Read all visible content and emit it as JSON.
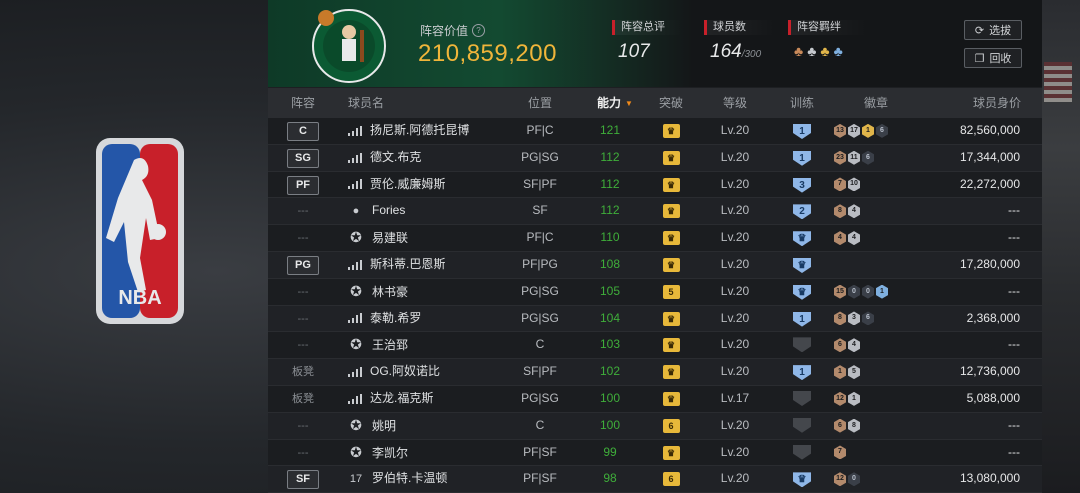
{
  "header": {
    "value_label": "阵容价值",
    "value": "210,859,200",
    "stats": [
      {
        "label": "阵容总评",
        "value": "107",
        "suffix": ""
      },
      {
        "label": "球员数",
        "value": "164",
        "suffix": "/300"
      },
      {
        "label": "阵容羁绊",
        "value": "",
        "suffix": ""
      }
    ],
    "buttons": [
      {
        "label": "选拔",
        "icon": "refresh-icon"
      },
      {
        "label": "回收",
        "icon": "recycle-icon"
      }
    ]
  },
  "columns": [
    "阵容",
    "球员名",
    "位置",
    "能力",
    "突破",
    "等级",
    "训练",
    "徽章",
    "球员身价"
  ],
  "rows": [
    {
      "slot": "C",
      "slot_type": "badge",
      "name": "扬尼斯.阿德托昆博",
      "icon": "bars-icon",
      "position": "PF|C",
      "ability": "121",
      "breakthrough": "",
      "level": "Lv.20",
      "training": "1",
      "badges": [
        [
          "bronze",
          "13"
        ],
        [
          "silver",
          "17"
        ],
        [
          "gold",
          "1"
        ],
        [
          "dark",
          "6"
        ]
      ],
      "salary": "82,560,000"
    },
    {
      "slot": "SG",
      "slot_type": "badge",
      "name": "德文.布克",
      "icon": "bars-icon",
      "position": "PG|SG",
      "ability": "112",
      "breakthrough": "",
      "level": "Lv.20",
      "training": "1",
      "badges": [
        [
          "bronze",
          "23"
        ],
        [
          "silver",
          "11"
        ],
        [
          "dark",
          "6"
        ]
      ],
      "salary": "17,344,000"
    },
    {
      "slot": "PF",
      "slot_type": "badge",
      "name": "贾伦.威廉姆斯",
      "icon": "bars-icon",
      "position": "SF|PF",
      "ability": "112",
      "breakthrough": "",
      "level": "Lv.20",
      "training": "3",
      "badges": [
        [
          "bronze",
          "7"
        ],
        [
          "silver",
          "10"
        ]
      ],
      "salary": "22,272,000"
    },
    {
      "slot": "---",
      "slot_type": "dash",
      "name": "Fories",
      "icon": "person-icon",
      "position": "SF",
      "ability": "112",
      "breakthrough": "",
      "level": "Lv.20",
      "training": "2",
      "badges": [
        [
          "bronze",
          "8"
        ],
        [
          "silver",
          "4"
        ]
      ],
      "salary": "---"
    },
    {
      "slot": "---",
      "slot_type": "dash",
      "name": "易建联",
      "icon": "star-icon",
      "position": "PF|C",
      "ability": "110",
      "breakthrough": "",
      "level": "Lv.20",
      "training": "",
      "badges": [
        [
          "bronze",
          "4"
        ],
        [
          "silver",
          "4"
        ]
      ],
      "salary": "---"
    },
    {
      "slot": "PG",
      "slot_type": "badge",
      "name": "斯科蒂.巴恩斯",
      "icon": "bars-icon",
      "position": "PF|PG",
      "ability": "108",
      "breakthrough": "",
      "level": "Lv.20",
      "training": "",
      "badges": [],
      "salary": "17,280,000"
    },
    {
      "slot": "---",
      "slot_type": "dash",
      "name": "林书豪",
      "icon": "star-icon",
      "position": "PG|SG",
      "ability": "105",
      "breakthrough": "5",
      "level": "Lv.20",
      "training": "",
      "badges": [
        [
          "bronze",
          "15"
        ],
        [
          "dark",
          "0"
        ],
        [
          "dark",
          "0"
        ],
        [
          "blue",
          "1"
        ]
      ],
      "salary": "---"
    },
    {
      "slot": "---",
      "slot_type": "dash",
      "name": "泰勒.希罗",
      "icon": "bars-icon",
      "position": "PG|SG",
      "ability": "104",
      "breakthrough": "",
      "level": "Lv.20",
      "training": "1",
      "badges": [
        [
          "bronze",
          "8"
        ],
        [
          "silver",
          "3"
        ],
        [
          "dark",
          "6"
        ]
      ],
      "salary": "2,368,000"
    },
    {
      "slot": "---",
      "slot_type": "dash",
      "name": "王治郅",
      "icon": "star-icon",
      "position": "C",
      "ability": "103",
      "breakthrough": "",
      "level": "Lv.20",
      "training": "grey",
      "badges": [
        [
          "bronze",
          "6"
        ],
        [
          "silver",
          "4"
        ]
      ],
      "salary": "---"
    },
    {
      "slot": "板凳",
      "slot_type": "bench",
      "name": "OG.阿奴诺比",
      "icon": "bars-icon",
      "position": "SF|PF",
      "ability": "102",
      "breakthrough": "",
      "level": "Lv.20",
      "training": "1",
      "badges": [
        [
          "bronze",
          "1"
        ],
        [
          "silver",
          "5"
        ]
      ],
      "salary": "12,736,000"
    },
    {
      "slot": "板凳",
      "slot_type": "bench",
      "name": "达龙.福克斯",
      "icon": "bars-icon",
      "position": "PG|SG",
      "ability": "100",
      "breakthrough": "",
      "level": "Lv.17",
      "training": "grey",
      "badges": [
        [
          "bronze",
          "12"
        ],
        [
          "silver",
          "1"
        ]
      ],
      "salary": "5,088,000"
    },
    {
      "slot": "---",
      "slot_type": "dash",
      "name": "姚明",
      "icon": "star-icon",
      "position": "C",
      "ability": "100",
      "breakthrough": "6",
      "level": "Lv.20",
      "training": "grey",
      "badges": [
        [
          "bronze",
          "6"
        ],
        [
          "silver",
          "8"
        ]
      ],
      "salary": "---"
    },
    {
      "slot": "---",
      "slot_type": "dash",
      "name": "李凯尔",
      "icon": "star-icon",
      "position": "PF|SF",
      "ability": "99",
      "breakthrough": "",
      "level": "Lv.20",
      "training": "grey",
      "badges": [
        [
          "bronze",
          "7"
        ]
      ],
      "salary": "---"
    },
    {
      "slot": "SF",
      "slot_type": "badge",
      "name": "罗伯特.卡温顿",
      "icon": "number-icon",
      "icon_text": "17",
      "position": "PF|SF",
      "ability": "98",
      "breakthrough": "6",
      "level": "Lv.20",
      "training": "",
      "badges": [
        [
          "bronze",
          "12"
        ],
        [
          "dark",
          "0"
        ]
      ],
      "salary": "13,080,000"
    }
  ]
}
